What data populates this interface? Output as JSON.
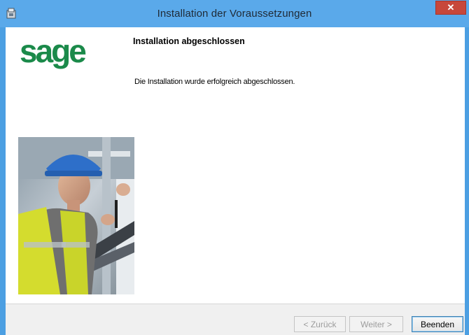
{
  "window": {
    "title": "Installation der Voraussetzungen",
    "close_label": "✕",
    "icon": "installer-icon"
  },
  "brand": {
    "logo_text": "sage",
    "logo_color": "#1b8a4a"
  },
  "content": {
    "heading": "Installation abgeschlossen",
    "message": "Die Installation wurde erfolgreich abgeschlossen.",
    "image": "worker-photo"
  },
  "buttons": {
    "back": "< Zurück",
    "next": "Weiter >",
    "finish": "Beenden"
  },
  "colors": {
    "titlebar": "#5aa9ea",
    "close": "#c7473b"
  }
}
